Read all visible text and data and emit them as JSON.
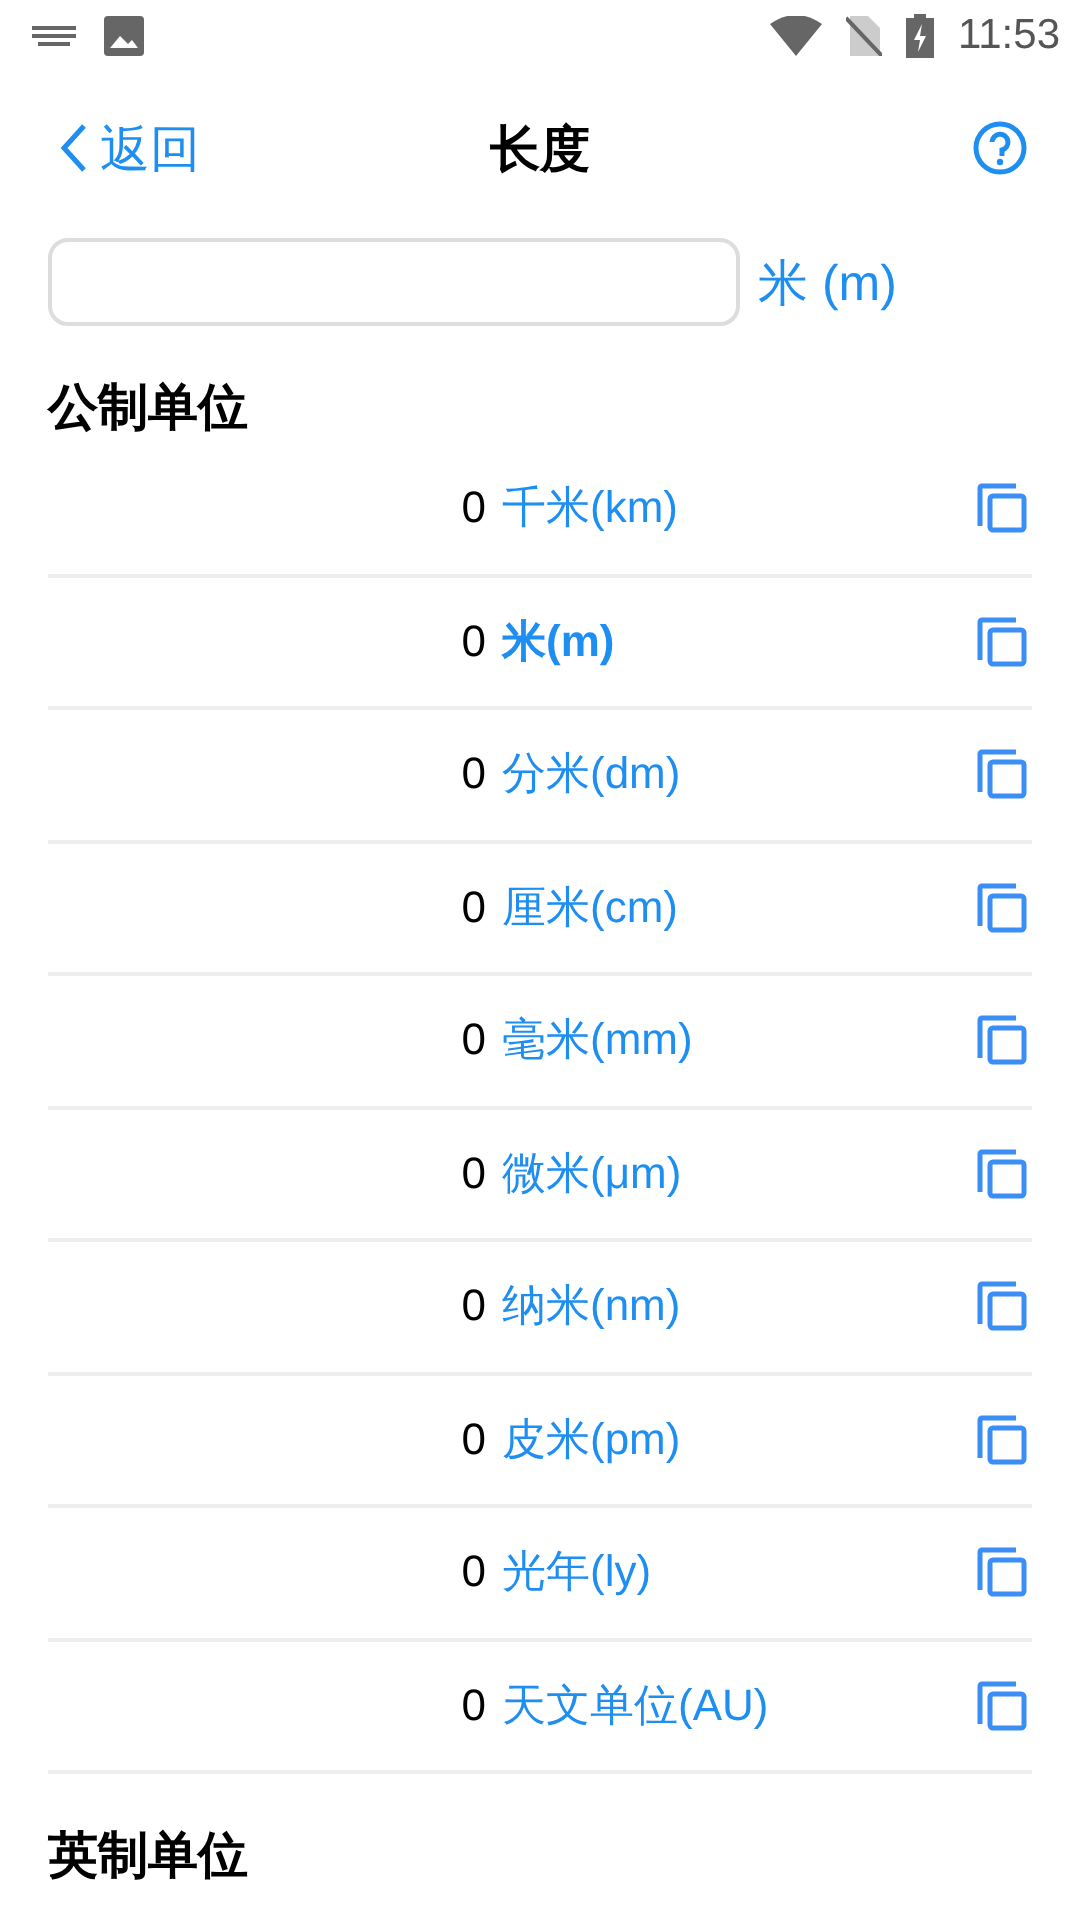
{
  "status_bar": {
    "time": "11:53"
  },
  "nav": {
    "back": "返回",
    "title": "长度"
  },
  "input": {
    "unit": "米 (m)"
  },
  "sections": [
    {
      "title": "公制单位",
      "rows": [
        {
          "value": "0",
          "unit": "千米(km)",
          "selected": false
        },
        {
          "value": "0",
          "unit": "米(m)",
          "selected": true
        },
        {
          "value": "0",
          "unit": "分米(dm)",
          "selected": false
        },
        {
          "value": "0",
          "unit": "厘米(cm)",
          "selected": false
        },
        {
          "value": "0",
          "unit": "毫米(mm)",
          "selected": false
        },
        {
          "value": "0",
          "unit": "微米(μm)",
          "selected": false
        },
        {
          "value": "0",
          "unit": "纳米(nm)",
          "selected": false
        },
        {
          "value": "0",
          "unit": "皮米(pm)",
          "selected": false
        },
        {
          "value": "0",
          "unit": "光年(ly)",
          "selected": false
        },
        {
          "value": "0",
          "unit": "天文单位(AU)",
          "selected": false
        }
      ]
    },
    {
      "title": "英制单位"
    }
  ]
}
